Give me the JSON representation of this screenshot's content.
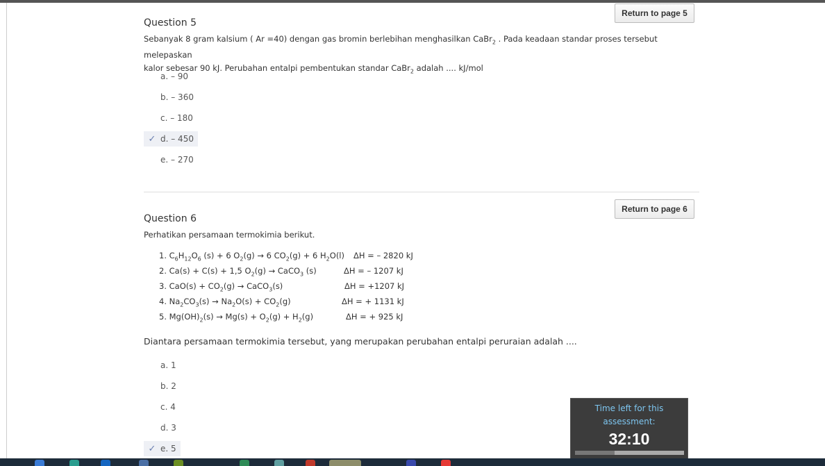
{
  "q5": {
    "return_label": "Return to page 5",
    "title": "Question 5",
    "text_line1": "Sebanyak 8 gram kalsium ( Ar =40) dengan gas bromin berlebihan menghasilkan CaBr",
    "text_line1_sub": "2",
    "text_line1_end": " . Pada keadaan standar proses tersebut melepaskan",
    "text_line2": "kalor sebesar 90 kJ. Perubahan entalpi pembentukan standar CaBr",
    "text_line2_sub": "2",
    "text_line2_end": " adalah .... kJ/mol",
    "options": [
      "a. – 90",
      "b. – 360",
      "c. – 180",
      "d. – 450",
      "e. – 270"
    ],
    "selected": "d"
  },
  "q6": {
    "return_label": "Return to page 6",
    "title": "Question 6",
    "intro": "Perhatikan persamaan termokimia berikut.",
    "equations": [
      {
        "dh": "ΔH = – 2820 kJ"
      },
      {
        "dh": "ΔH = – 1207 kJ"
      },
      {
        "dh": "ΔH = +1207 kJ"
      },
      {
        "dh": "ΔH = + 1131 kJ"
      },
      {
        "dh": "ΔH = + 925 kJ"
      }
    ],
    "question": "Diantara persamaan termokimia tersebut, yang merupakan perubahan entalpi peruraian adalah ....",
    "options": [
      "a. 1",
      "b. 2",
      "c. 4",
      "d. 3",
      "e. 5"
    ],
    "selected": "e"
  },
  "timer": {
    "label": "Time left for this assessment:",
    "time": "32:10",
    "progress": 0.36
  },
  "icons": {
    "check": "check-icon"
  }
}
